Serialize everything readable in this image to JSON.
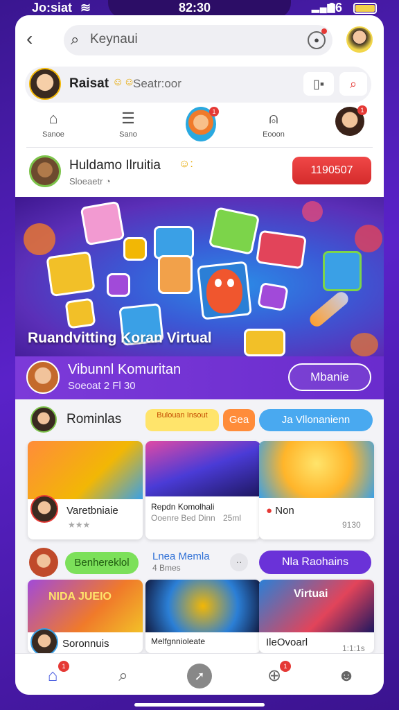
{
  "status_bar": {
    "left_label": "Jo:siat",
    "time": "82:30",
    "battery_pct": "36"
  },
  "search": {
    "placeholder": "Keynaui"
  },
  "profile": {
    "name": "Raisat",
    "status": "Seatr:oor"
  },
  "nav": {
    "items": [
      {
        "label": "Sanoe",
        "icon": "home-icon"
      },
      {
        "label": "Sano",
        "icon": "list-icon"
      },
      {
        "label": "Eooon",
        "icon": "bell-icon"
      }
    ],
    "center_badge": "1",
    "avatar_badge": "1"
  },
  "channel": {
    "title": "Huldamo Ilruitia",
    "subtitle": "Sloeaetr",
    "button": "1190507"
  },
  "hero": {
    "title": "Ruandvitting Koran Virtual"
  },
  "purple_bar": {
    "title": "Vibunnl Komuritan",
    "subtitle": "Soeoat 2 Fl 30",
    "button": "Mbanie"
  },
  "section1": {
    "title": "Rominlas",
    "pill_yellow": "Bulouan Insout",
    "pill_orange": "Gea",
    "pill_blue": "Ja Vllonanienn",
    "cards": [
      {
        "title": "Varetbniaie",
        "rating": "★★★",
        "accent": "#ff8c3a"
      },
      {
        "title": "Repdn Komolhali",
        "subtitle": "Ooenre Bed Dinn",
        "meta": "25ml",
        "accent": "#6a2bd0"
      },
      {
        "title": "Non",
        "meta": "9130",
        "accent": "#ffd43a"
      }
    ]
  },
  "section2": {
    "pill_green": "Benhereklol",
    "title": "Lnea Memla",
    "subtitle": "4 Bmes",
    "more": "··",
    "pill_purple": "Nla Raohains",
    "cards": [
      {
        "title": "Soronnuis",
        "banner": "NIDA JUEIO"
      },
      {
        "title": "Melfgnnioleate"
      },
      {
        "title": "IleOvoarl",
        "banner": "Virtuai",
        "meta": "1:1:1s"
      }
    ]
  },
  "bottom_nav": {
    "home_badge": "1",
    "games_badge": "1"
  }
}
